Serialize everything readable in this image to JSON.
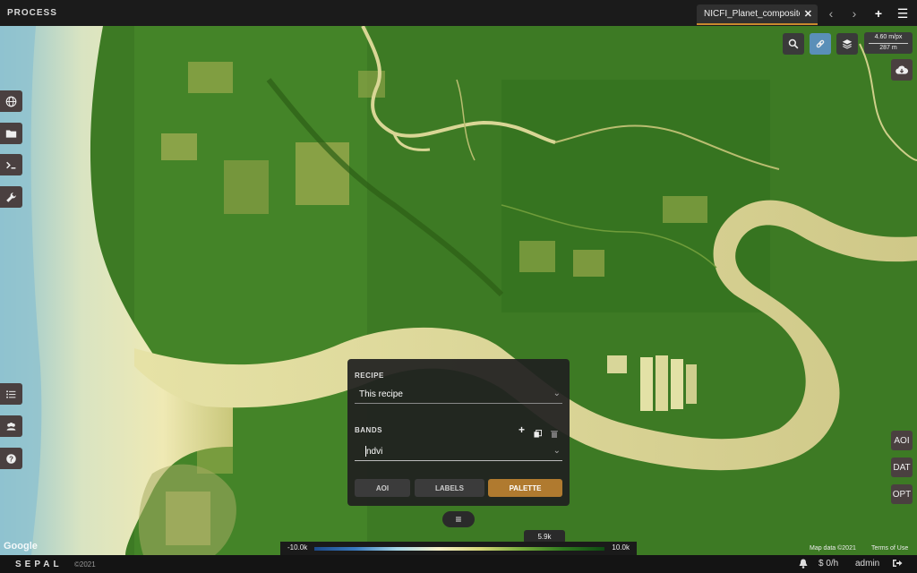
{
  "topbar": {
    "section_title": "PROCESS",
    "tab_label": "NICFI_Planet_composite",
    "icons": [
      "close-icon",
      "chevron-left-icon",
      "chevron-right-icon",
      "plus-icon",
      "menu-icon"
    ]
  },
  "map_controls": {
    "scale_top": "4.60 m/px",
    "scale_bottom": "287 m",
    "buttons": [
      "search-icon",
      "link-icon",
      "layers-icon",
      "cloud-download-icon"
    ],
    "active_color": "#5a8fb8"
  },
  "left_sidebar": {
    "items": [
      "globe-icon",
      "folder-icon",
      "terminal-icon",
      "wrench-icon"
    ],
    "bottom_items": [
      "task-list-icon",
      "users-icon",
      "help-icon"
    ]
  },
  "right_panel_buttons": {
    "aoi": "AOI",
    "dat": "DAT",
    "opt": "OPT"
  },
  "layer_panel": {
    "recipe_label": "RECIPE",
    "recipe_value": "This recipe",
    "bands_label": "BANDS",
    "bands_value": "ndvi",
    "buttons": {
      "aoi": "AOI",
      "labels": "LABELS",
      "palette": "PALETTE"
    },
    "accent": "#b07a2f"
  },
  "legend": {
    "min": "-10.0k",
    "max": "10.0k",
    "current": "5.9k"
  },
  "attribution": {
    "google": "Google",
    "map_data": "Map data ©2021",
    "terms": "Terms of Use"
  },
  "bottombar": {
    "brand": "SEPAL",
    "copyright": "©2021",
    "rate": "$ 0/h",
    "user": "admin"
  }
}
